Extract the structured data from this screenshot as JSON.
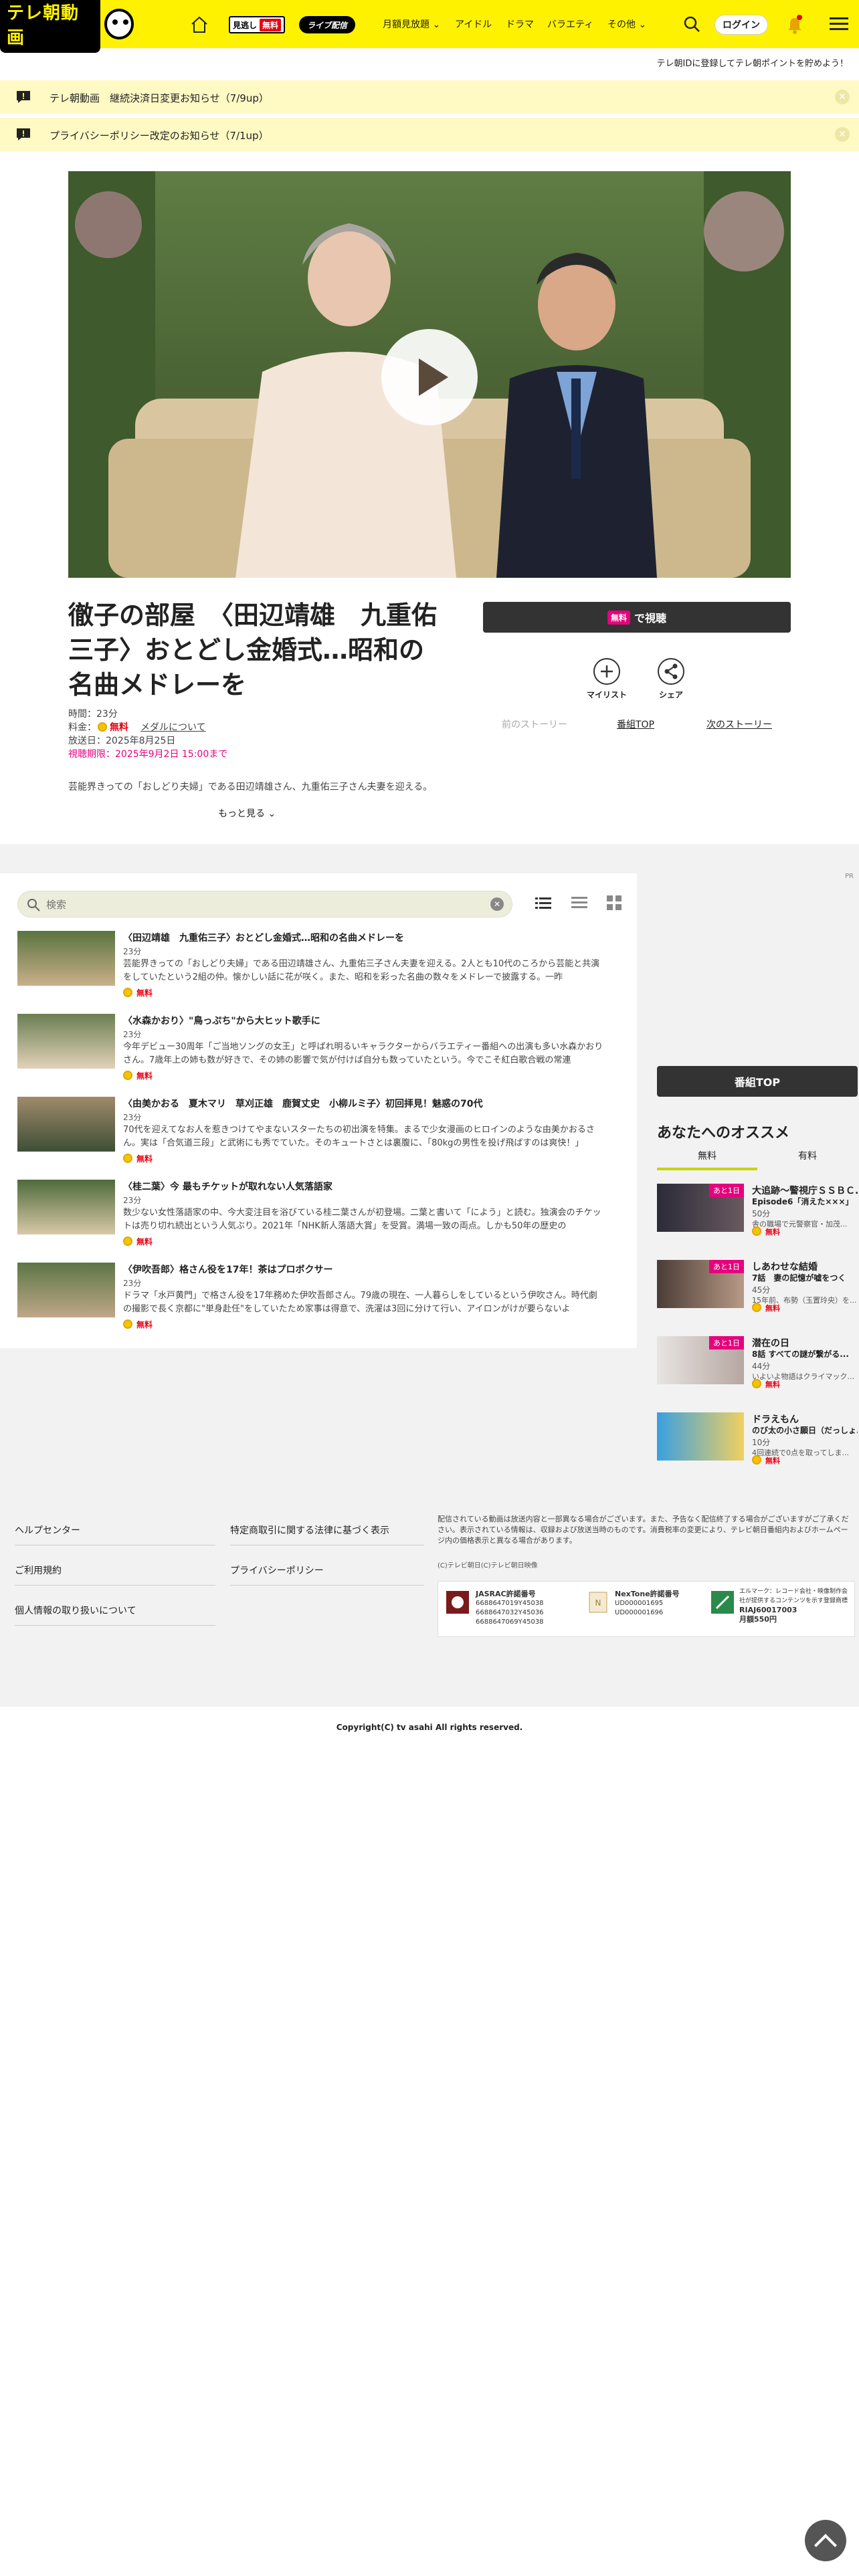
{
  "header": {
    "logo_text": "テレ朝動画",
    "free_label": "見逃し",
    "free_badge": "無料",
    "live_label": "ライブ配信",
    "nav": [
      "月額見放題",
      "アイドル",
      "ドラマ",
      "バラエティ",
      "その他"
    ],
    "login": "ログイン",
    "brand_color": "#fff200"
  },
  "point_banner": "テレ朝IDに登録してテレ朝ポイントを貯めよう！",
  "notices": [
    {
      "text": "テレ朝動画　継続決済日変更お知らせ（7/9up）"
    },
    {
      "text": "プライバシーポリシー改定のお知らせ（7/1up）"
    }
  ],
  "episode": {
    "title": "徹子の部屋　〈田辺靖雄　九重佑三子〉おとどし金婚式…昭和の名曲メドレーを",
    "duration": "時間：23分",
    "fee_label": "料金：",
    "fee_value": "無料",
    "fee_link": "メダルについて",
    "air_date": "放送日：2025年8月25日",
    "expire": "視聴期限：2025年9月2日 15:00まで",
    "description": "芸能界きっての「おしどり夫婦」である田辺靖雄さん、九重佑三子さん夫妻を迎える。2人",
    "more": "もっと見る",
    "watch_tag": "無料",
    "watch_label": "で視聴",
    "mylist": "マイリスト",
    "share": "シェア",
    "prev": "前のストーリー",
    "top": "番組TOP",
    "next": "次のストーリー"
  },
  "pr": "PR",
  "list": {
    "search_placeholder": "検索",
    "items": [
      {
        "title": "〈田辺靖雄　九重佑三子〉おとどし金婚式…昭和の名曲メドレーを",
        "duration": "23分",
        "desc": "芸能界きっての「おしどり夫婦」である田辺靖雄さん、九重佑三子さん夫妻を迎える。2人とも10代のころから芸能と共演をしていたという2組の仲。懐かしい話に花が咲く。また、昭和を彩った名曲の数々をメドレーで披露する。一昨",
        "free": "無料"
      },
      {
        "title": "〈水森かおり〉\"鳥っぷち\"から大ヒット歌手に",
        "duration": "23分",
        "desc": "今年デビュー30周年「ご当地ソングの女王」と呼ばれ明るいキャラクターからバラエティー番組への出演も多い水森かおりさん。7歳年上の姉も数が好きで、その姉の影響で気が付けば自分も数っていたという。今でこそ紅白歌合戦の常連",
        "free": "無料"
      },
      {
        "title": "〈由美かおる　夏木マリ　草刈正雄　鹿賀丈史　小柳ルミ子〉初回拝見！魅惑の70代",
        "duration": "23分",
        "desc": "70代を迎えてなお人を惹きつけてやまないスターたちの初出演を特集。まるで少女漫画のヒロインのような由美かおるさん。実は「合気道三段」と武術にも秀でていた。そのキュートさとは裏腹に、「80kgの男性を投げ飛ばすのは爽快！」",
        "free": "無料"
      },
      {
        "title": "〈桂二葉〉今 最もチケットが取れない人気落語家",
        "duration": "23分",
        "desc": "数少ない女性落語家の中、今大変注目を浴びている桂二葉さんが初登場。二葉と書いて「によう」と読む。独演会のチケットは売り切れ続出という人気ぶり。2021年「NHK新人落語大賞」を受賞。満場一致の両点。しかも50年の歴史の",
        "free": "無料"
      },
      {
        "title": "〈伊吹吾郎〉格さん役を17年！茶はプロボクサー",
        "duration": "23分",
        "desc": "ドラマ「水戸黄門」で格さん役を17年務めた伊吹吾郎さん。79歳の現在、一人暮らしをしているという伊吹さん。時代劇の撮影で長く京都に\"単身赴任\"をしていたため家事は得意で、洗濯は3回に分けて行い、アイロンがけが要らないよ",
        "free": "無料"
      }
    ]
  },
  "sidebar": {
    "program_top": "番組TOP",
    "rec_title": "あなたへのオススメ",
    "tabs": [
      "無料",
      "有料"
    ],
    "items": [
      {
        "badge": "あと1日",
        "name": "大追跡～警視庁ＳＳＢＣ...",
        "sub": "Episode6「消えた×××」",
        "duration": "50分",
        "desc": "舎の職場で元警察官・加茂...",
        "free": "無料"
      },
      {
        "badge": "あと1日",
        "name": "しあわせな結婚",
        "sub": "7話　妻の記憶が嘘をつく",
        "duration": "45分",
        "desc": "15年前、布勢（玉置玲央）を...",
        "free": "無料"
      },
      {
        "badge": "あと1日",
        "name": "潜在の日",
        "sub": "8話 すべての謎が繋がる...",
        "duration": "44分",
        "desc": "いよいよ物語はクライマック...",
        "free": "無料"
      },
      {
        "badge": "",
        "name": "ドラえもん",
        "sub": "のび太の小さ願日（だっしょ...",
        "duration": "10分",
        "desc": "4回連続で0点を取ってしま...",
        "free": "無料"
      }
    ]
  },
  "footer": {
    "links_left": [
      "ヘルプセンター",
      "ご利用規約",
      "個人情報の取り扱いについて"
    ],
    "links_right": [
      "特定商取引に関する法律に基づく表示",
      "プライバシーポリシー"
    ],
    "notes": "配信されている動画は放送内容と一部異なる場合がございます。また、予告なく配信終了する場合がございますがご了承ください。表示されている情報は、収録および放送当時のものです。消費税率の変更により、テレビ朝日番組内およびホームページ内の価格表示と異なる場合があります。",
    "credit": "(C)テレビ朝日(C)テレビ朝日映像",
    "jasrac_name": "JASRAC許諾番号",
    "jasrac_nums": [
      "6688647019Y45038",
      "6688647032Y45036",
      "6688647069Y45038"
    ],
    "nextone_name": "NexTone許諾番号",
    "nextone_nums": [
      "UD000001695",
      "UD000001696"
    ],
    "ekimae_note": "エルマーク：レコード会社・映像制作会社が提供するコンテンツを示す登録商標",
    "ekimae_num": "RIAJ60017003",
    "monthly": "月額550円",
    "copyright": "Copyright(C) tv asahi All rights reserved."
  }
}
